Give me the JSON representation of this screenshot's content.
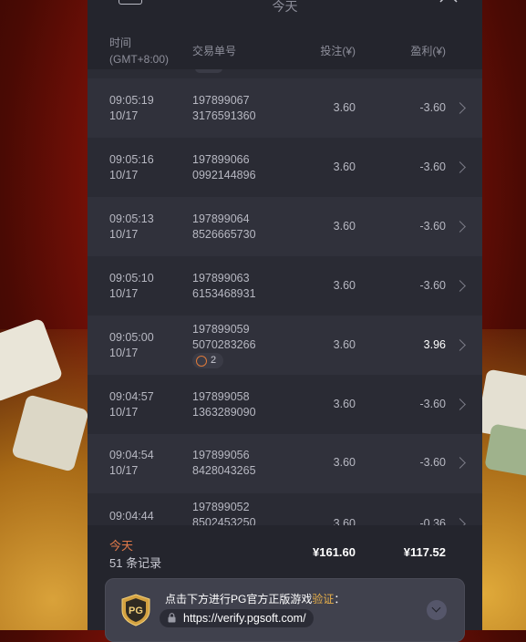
{
  "page": {
    "title": "今天"
  },
  "table_header": {
    "time": "时间",
    "timezone": "(GMT+8:00)",
    "order": "交易单号",
    "bet": "投注(¥)",
    "win": "盈利(¥)"
  },
  "rows": [
    {
      "time": "09:05:19",
      "date": "10/17",
      "order1": "197899067",
      "order2": "3176591360",
      "bet": "3.60",
      "win": "-3.60"
    },
    {
      "time": "09:05:16",
      "date": "10/17",
      "order1": "197899066",
      "order2": "0992144896",
      "bet": "3.60",
      "win": "-3.60"
    },
    {
      "time": "09:05:13",
      "date": "10/17",
      "order1": "197899064",
      "order2": "8526665730",
      "bet": "3.60",
      "win": "-3.60"
    },
    {
      "time": "09:05:10",
      "date": "10/17",
      "order1": "197899063",
      "order2": "6153468931",
      "bet": "3.60",
      "win": "-3.60"
    },
    {
      "time": "09:05:00",
      "date": "10/17",
      "order1": "197899059",
      "order2": "5070283266",
      "bet": "3.60",
      "win": "3.96",
      "badge": "2"
    },
    {
      "time": "09:04:57",
      "date": "10/17",
      "order1": "197899058",
      "order2": "1363289090",
      "bet": "3.60",
      "win": "-3.60"
    },
    {
      "time": "09:04:54",
      "date": "10/17",
      "order1": "197899056",
      "order2": "8428043265",
      "bet": "3.60",
      "win": "-3.60"
    },
    {
      "time": "09:04:44",
      "date": "",
      "order1": "197899052",
      "order2": "8502453250",
      "bet": "3.60",
      "win": "-0.36"
    }
  ],
  "footer": {
    "period": "今天",
    "count": "51 条记录",
    "total_bet": "¥161.60",
    "total_win": "¥117.52"
  },
  "verify": {
    "text": "点击下方进行PG官方正版游戏",
    "highlight": "验证",
    "colon": "：",
    "url": "https://verify.pgsoft.com/",
    "logo": "PG"
  }
}
